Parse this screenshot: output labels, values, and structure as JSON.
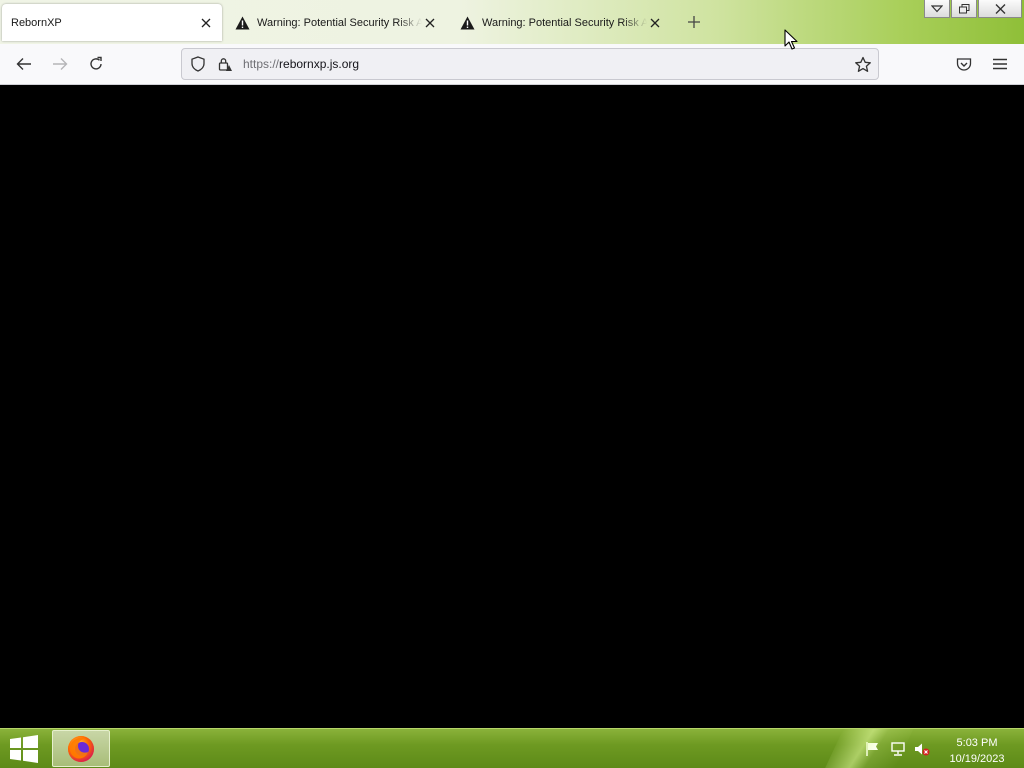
{
  "browser": {
    "tabs": [
      {
        "title": "RebornXP",
        "active": true,
        "icon": "none"
      },
      {
        "title": "Warning: Potential Security Risk Ahead",
        "active": false,
        "icon": "warning-icon"
      },
      {
        "title": "Warning: Potential Security Risk Ahead",
        "active": false,
        "icon": "warning-icon"
      }
    ],
    "url": {
      "scheme": "https://",
      "host": "rebornxp.js.org"
    }
  },
  "taskbar": {
    "pinned_apps": [
      "firefox-icon"
    ],
    "clock": {
      "time": "5:03 PM",
      "date": "10/19/2023"
    }
  },
  "colors": {
    "taskbar": "#6e9a22",
    "page_background": "#000000",
    "tab_active": "#ffffff"
  }
}
